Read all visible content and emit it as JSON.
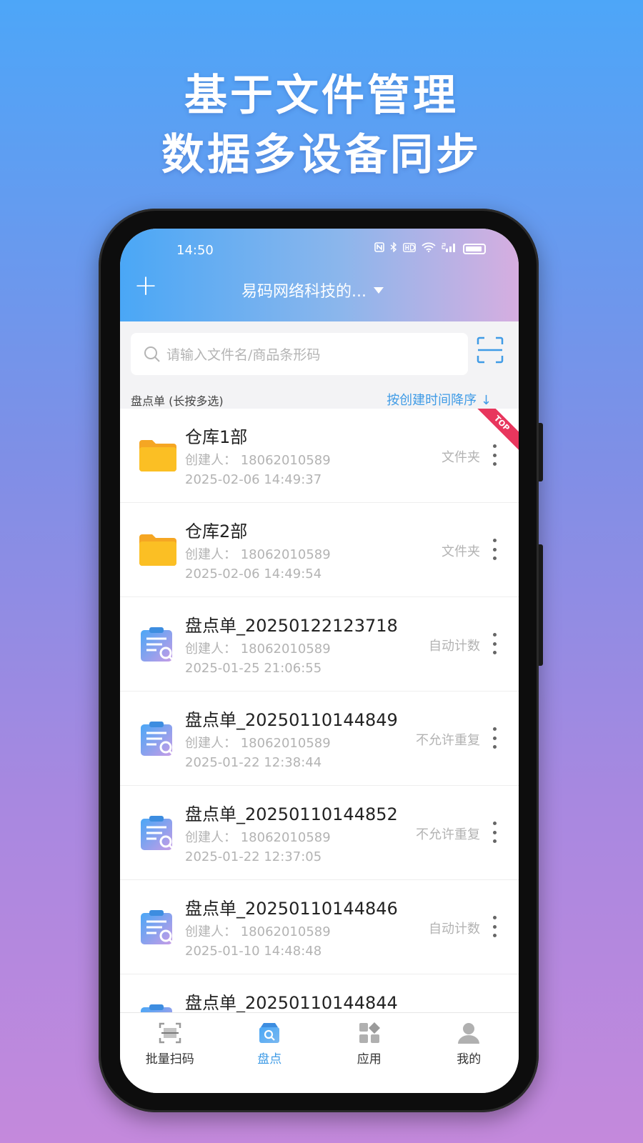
{
  "banner": {
    "line1": "基于文件管理",
    "line2": "数据多设备同步"
  },
  "status_bar": {
    "time": "14:50",
    "icons": [
      "nfc-icon",
      "bluetooth-icon",
      "hd-icon",
      "wifi-icon",
      "5g-signal-icon",
      "battery-icon"
    ]
  },
  "header": {
    "add_label": "+",
    "org_name": "易码网络科技的..."
  },
  "search": {
    "placeholder": "请输入文件名/商品条形码"
  },
  "list": {
    "heading": "盘点单 (长按多选)",
    "sort_label": "按创建时间降序 ↓",
    "top_badge": "TOP",
    "items": [
      {
        "title": "仓库1部",
        "creator": "创建人：  18062010589",
        "time": "2025-02-06 14:49:37",
        "tag": "文件夹",
        "type": "folder"
      },
      {
        "title": "仓库2部",
        "creator": "创建人：  18062010589",
        "time": "2025-02-06 14:49:54",
        "tag": "文件夹",
        "type": "folder"
      },
      {
        "title": "盘点单_20250122123718",
        "creator": "创建人：  18062010589",
        "time": "2025-01-25 21:06:55",
        "tag": "自动计数",
        "type": "sheet"
      },
      {
        "title": "盘点单_20250110144849",
        "creator": "创建人：  18062010589",
        "time": "2025-01-22 12:38:44",
        "tag": "不允许重复",
        "type": "sheet"
      },
      {
        "title": "盘点单_20250110144852",
        "creator": "创建人：  18062010589",
        "time": "2025-01-22 12:37:05",
        "tag": "不允许重复",
        "type": "sheet"
      },
      {
        "title": "盘点单_20250110144846",
        "creator": "创建人：  18062010589",
        "time": "2025-01-10 14:48:48",
        "tag": "自动计数",
        "type": "sheet"
      },
      {
        "title": "盘点单_20250110144844",
        "creator": "",
        "time": "",
        "tag": "",
        "type": "sheet"
      }
    ]
  },
  "tabs": [
    {
      "label": "批量扫码",
      "icon": "scan-frame-icon",
      "active": false
    },
    {
      "label": "盘点",
      "icon": "inventory-box-icon",
      "active": true
    },
    {
      "label": "应用",
      "icon": "apps-grid-icon",
      "active": false
    },
    {
      "label": "我的",
      "icon": "user-icon",
      "active": false
    }
  ],
  "colors": {
    "accent": "#3f9be6",
    "folder": "#fbbf24",
    "top_badge": "#e8365d"
  }
}
